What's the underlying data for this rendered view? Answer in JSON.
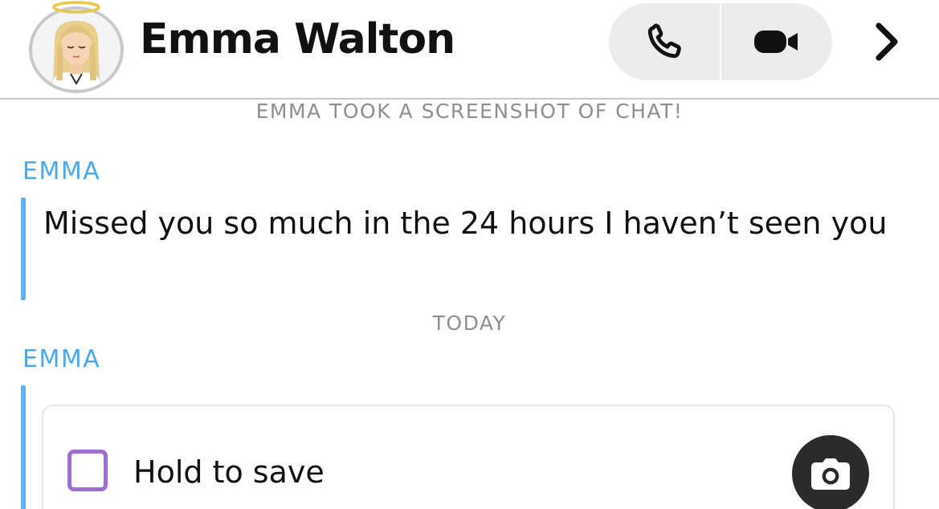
{
  "header": {
    "contact_name": "Emma Walton",
    "voice_call_icon": "phone-icon",
    "video_call_icon": "video-camera-icon",
    "details_icon": "chevron-right-icon",
    "avatar_icon": "bitmoji-avatar-with-halo"
  },
  "chat": {
    "system_note": "EMMA TOOK A SCREENSHOT OF CHAT!",
    "messages": [
      {
        "sender": "EMMA",
        "text": "Missed you so much in the 24 hours I haven’t seen you"
      }
    ],
    "day_divider": "TODAY",
    "snap": {
      "sender": "EMMA",
      "save_label": "Hold to save",
      "camera_icon": "camera-icon"
    }
  },
  "colors": {
    "sender_name": "#4aa8f0",
    "message_bar": "#5cb4f5",
    "checkbox_border": "#9d6fd3",
    "call_pill_bg": "#ececee",
    "system_text": "#8e8e93",
    "camera_button_bg": "#2b2b2e"
  }
}
